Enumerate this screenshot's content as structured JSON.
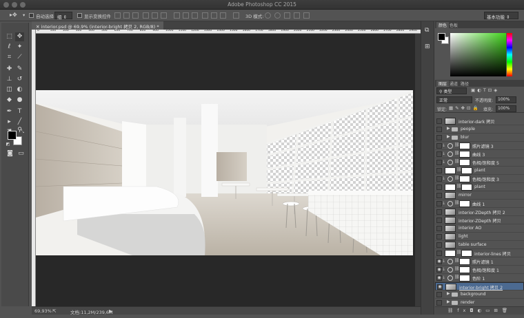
{
  "window": {
    "title": "Adobe Photoshop CC 2015"
  },
  "options_bar": {
    "auto_select_label": "自动选择:",
    "auto_select_value": "组",
    "show_transform_label": "显示变换控件",
    "mode_3d_label": "3D 模式:",
    "workspace": "基本功能"
  },
  "document": {
    "tab_title": "interior.psd @ 69,9% (interior-bright 拷贝 2, RGB/8) *",
    "ruler_ticks": [
      "0",
      "100",
      "200",
      "300",
      "400",
      "500",
      "600",
      "700",
      "800",
      "900",
      "1000",
      "1100",
      "1200",
      "1300",
      "1400",
      "1500",
      "1600",
      "1700",
      "1800",
      "1900",
      "2000",
      "2100",
      "2200",
      "2300",
      "2400",
      "2500",
      "2600",
      "2700",
      "2800",
      "2900"
    ]
  },
  "status_bar": {
    "zoom": "69,93%",
    "doc_info": "文档:11,2M/239,6M"
  },
  "color_panel": {
    "tabs": [
      "颜色",
      "色板"
    ]
  },
  "layers_panel": {
    "tabs": [
      "图层",
      "通道",
      "路径"
    ],
    "filter_kind": "类型",
    "blend_mode": "正常",
    "opacity_label": "不透明度:",
    "opacity_value": "100%",
    "lock_label": "锁定:",
    "fill_label": "填充:",
    "fill_value": "100%",
    "layers": [
      {
        "name": "interior-dark 拷贝",
        "type": "pixel",
        "visible": false,
        "selected": false
      },
      {
        "name": "people",
        "type": "group",
        "visible": false,
        "selected": false
      },
      {
        "name": "blur",
        "type": "group",
        "visible": false,
        "selected": false
      },
      {
        "name": "照片滤镜 3",
        "type": "adjustment",
        "visible": false,
        "selected": false
      },
      {
        "name": "曲线 3",
        "type": "adjustment",
        "visible": false,
        "selected": false
      },
      {
        "name": "色相/饱和度 5",
        "type": "adjustment",
        "visible": false,
        "selected": false
      },
      {
        "name": "plant",
        "type": "masked",
        "visible": false,
        "selected": false
      },
      {
        "name": "色相/饱和度 3",
        "type": "adjustment",
        "visible": false,
        "selected": false
      },
      {
        "name": "plant",
        "type": "masked",
        "visible": false,
        "selected": false
      },
      {
        "name": "mirror",
        "type": "pixel",
        "visible": false,
        "selected": false
      },
      {
        "name": "曲线 1",
        "type": "adjustment",
        "visible": false,
        "selected": false
      },
      {
        "name": "interior-ZDepth 拷贝 2",
        "type": "pixel",
        "visible": false,
        "selected": false
      },
      {
        "name": "interior-ZDepth 拷贝",
        "type": "pixel",
        "visible": false,
        "selected": false
      },
      {
        "name": "interior AO",
        "type": "pixel",
        "visible": false,
        "selected": false
      },
      {
        "name": "light",
        "type": "pixel",
        "visible": false,
        "selected": false
      },
      {
        "name": "table surface",
        "type": "pixel",
        "visible": false,
        "selected": false
      },
      {
        "name": "interior-lines 拷贝",
        "type": "masked",
        "visible": false,
        "selected": false
      },
      {
        "name": "照片滤镜 1",
        "type": "adjustment",
        "visible": true,
        "selected": false
      },
      {
        "name": "色相/饱和度 1",
        "type": "adjustment",
        "visible": true,
        "selected": false
      },
      {
        "name": "色阶 1",
        "type": "adjustment",
        "visible": true,
        "selected": false
      },
      {
        "name": "interior-bright 拷贝 2",
        "type": "pixel",
        "visible": true,
        "selected": true
      },
      {
        "name": "background",
        "type": "group",
        "visible": false,
        "selected": false
      },
      {
        "name": "render",
        "type": "group",
        "visible": false,
        "selected": false
      }
    ]
  },
  "colors": {
    "foreground": "#000000",
    "background": "#ffffff",
    "selection": "#4c6a91"
  }
}
